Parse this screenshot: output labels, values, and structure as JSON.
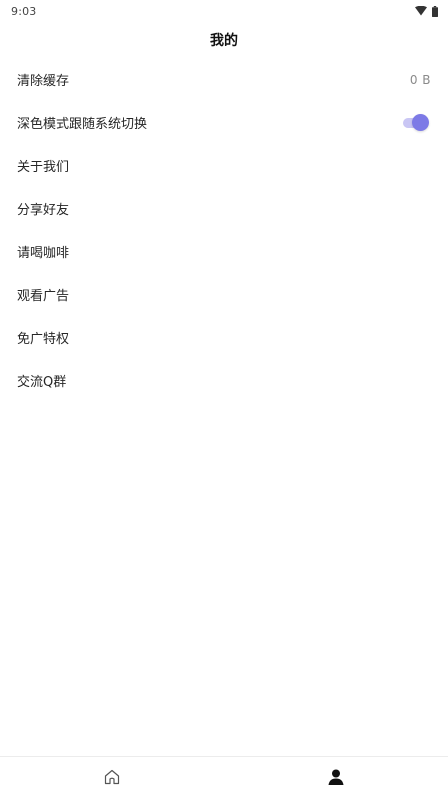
{
  "status_bar": {
    "time": "9:03",
    "icons": [
      "wifi-icon",
      "battery-icon"
    ]
  },
  "header": {
    "title": "我的"
  },
  "menu": {
    "items": [
      {
        "label": "清除缓存",
        "value": "0 B"
      },
      {
        "label": "深色模式跟随系统切换",
        "toggle_on": true
      },
      {
        "label": "关于我们"
      },
      {
        "label": "分享好友"
      },
      {
        "label": "请喝咖啡"
      },
      {
        "label": "观看广告"
      },
      {
        "label": "免广特权"
      },
      {
        "label": "交流Q群"
      }
    ]
  },
  "bottom_nav": {
    "tabs": [
      {
        "icon": "home-icon",
        "selected": false
      },
      {
        "icon": "person-icon",
        "selected": true
      }
    ]
  },
  "colors": {
    "accent": "#7d7ae6",
    "accent_track": "#c9c6f4",
    "text": "#262626",
    "muted": "#8a8a8a"
  }
}
